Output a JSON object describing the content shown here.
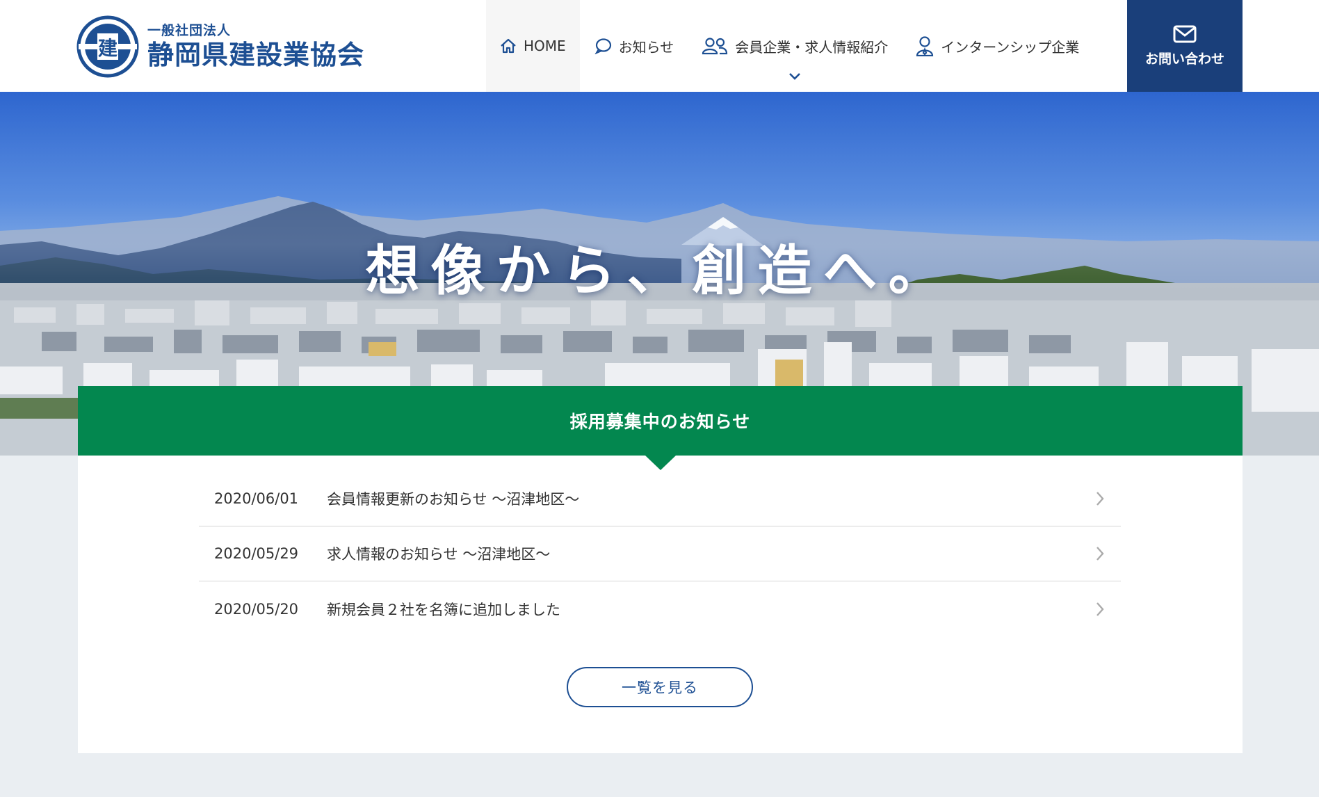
{
  "header": {
    "logo": {
      "sub": "一般社団法人",
      "main": "静岡県建設業協会",
      "emblem_char": "建",
      "emblem_color": "#1d4f93"
    },
    "nav": [
      {
        "label": "HOME",
        "icon": "home-icon",
        "active": true
      },
      {
        "label": "お知らせ",
        "icon": "speech-bubble-icon"
      },
      {
        "label": "会員企業・求人情報紹介",
        "icon": "users-icon",
        "has_dropdown": true
      },
      {
        "label": "インターンシップ企業",
        "icon": "user-badge-icon"
      }
    ],
    "contact": {
      "label": "お問い合わせ",
      "icon": "mail-icon",
      "color": "#1a3f7a"
    }
  },
  "hero": {
    "title": "想像から、創造へ。"
  },
  "news": {
    "heading": "採用募集中のお知らせ",
    "heading_color": "#03874f",
    "items": [
      {
        "date": "2020/06/01",
        "title": "会員情報更新のお知らせ ～沼津地区～"
      },
      {
        "date": "2020/05/29",
        "title": "求人情報のお知らせ ～沼津地区～"
      },
      {
        "date": "2020/05/20",
        "title": "新規会員２社を名簿に追加しました"
      }
    ],
    "more_label": "一覧を見る"
  }
}
